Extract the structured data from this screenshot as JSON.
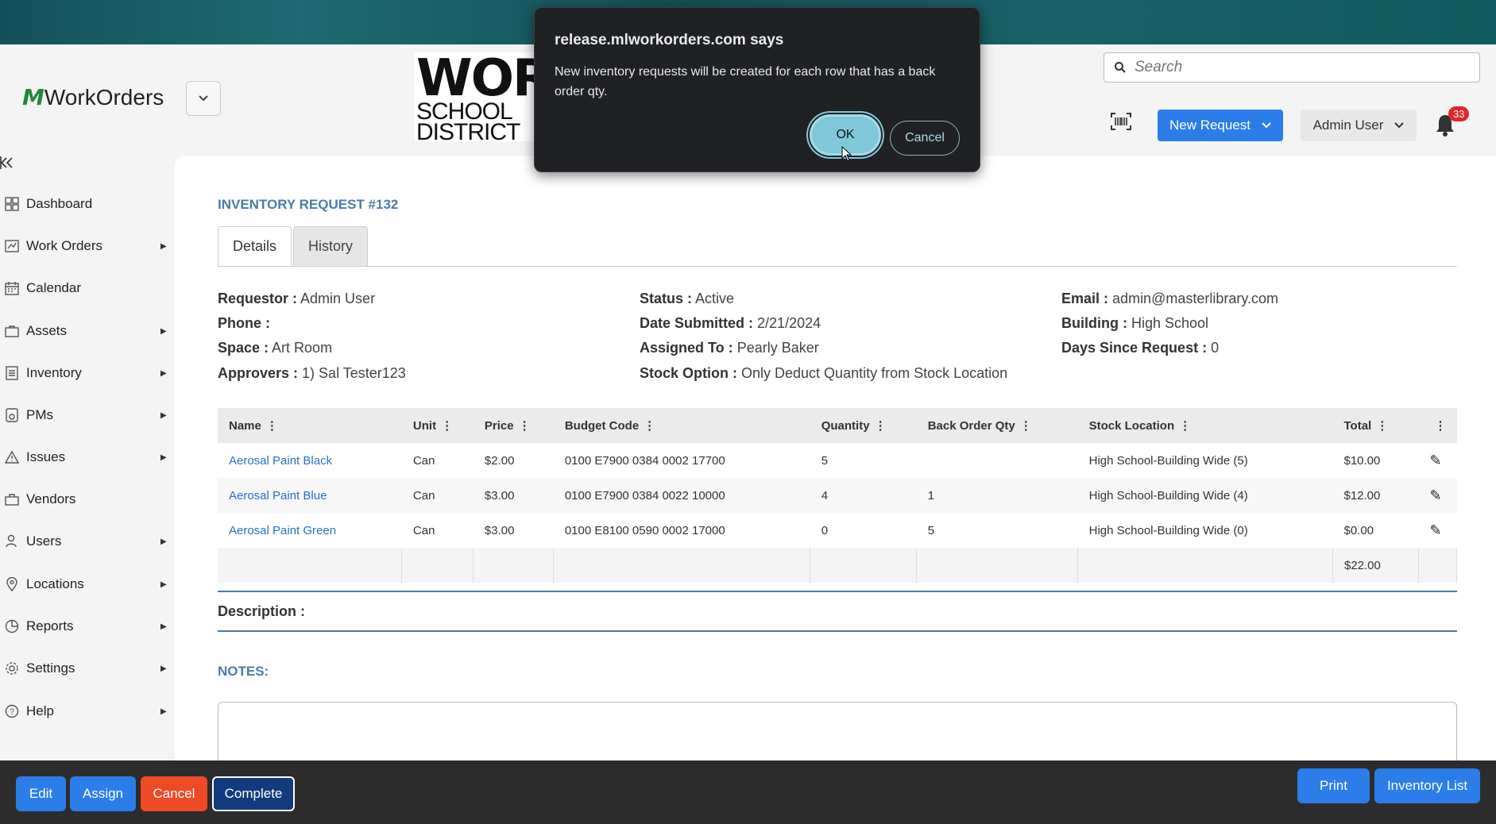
{
  "header": {
    "brand_name": "WorkOrders",
    "district_big": "WOR",
    "district_line1": "SCHOOL",
    "district_line2": "DISTRICT",
    "search_placeholder": "Search",
    "new_request_label": "New Request",
    "user_label": "Admin User",
    "notification_count": "33"
  },
  "sidebar": {
    "items": [
      {
        "label": "Dashboard",
        "icon": "dashboard-icon",
        "has_submenu": false
      },
      {
        "label": "Work Orders",
        "icon": "work-orders-icon",
        "has_submenu": true
      },
      {
        "label": "Calendar",
        "icon": "calendar-icon",
        "has_submenu": false
      },
      {
        "label": "Assets",
        "icon": "assets-icon",
        "has_submenu": true
      },
      {
        "label": "Inventory",
        "icon": "inventory-icon",
        "has_submenu": true
      },
      {
        "label": "PMs",
        "icon": "pms-icon",
        "has_submenu": true
      },
      {
        "label": "Issues",
        "icon": "issues-icon",
        "has_submenu": true
      },
      {
        "label": "Vendors",
        "icon": "vendors-icon",
        "has_submenu": false
      },
      {
        "label": "Users",
        "icon": "users-icon",
        "has_submenu": true
      },
      {
        "label": "Locations",
        "icon": "locations-icon",
        "has_submenu": true
      },
      {
        "label": "Reports",
        "icon": "reports-icon",
        "has_submenu": true
      },
      {
        "label": "Settings",
        "icon": "settings-icon",
        "has_submenu": true
      },
      {
        "label": "Help",
        "icon": "help-icon",
        "has_submenu": true
      }
    ]
  },
  "request": {
    "title": "INVENTORY REQUEST #132",
    "tabs": [
      "Details",
      "History"
    ],
    "fields": {
      "requestor_label": "Requestor :",
      "requestor": "Admin User",
      "phone_label": "Phone :",
      "phone": "",
      "space_label": "Space :",
      "space": "Art Room",
      "approvers_label": "Approvers :",
      "approvers": "1) Sal Tester123",
      "status_label": "Status :",
      "status": "Active",
      "date_label": "Date Submitted :",
      "date": "2/21/2024",
      "assigned_label": "Assigned To :",
      "assigned": "Pearly Baker",
      "stock_label": "Stock Option :",
      "stock": "Only Deduct Quantity from Stock Location",
      "email_label": "Email :",
      "email": "admin@masterlibrary.com",
      "building_label": "Building :",
      "building": "High School",
      "days_label": "Days Since Request :",
      "days": "0"
    },
    "table": {
      "headers": [
        "Name",
        "Unit",
        "Price",
        "Budget Code",
        "Quantity",
        "Back Order Qty",
        "Stock Location",
        "Total"
      ],
      "rows": [
        {
          "name": "Aerosal Paint Black",
          "unit": "Can",
          "price": "$2.00",
          "budget": "0100 E7900 0384 0002 17700",
          "qty": "5",
          "backorder": "",
          "stock": "High School-Building Wide (5)",
          "total": "$10.00"
        },
        {
          "name": "Aerosal Paint Blue",
          "unit": "Can",
          "price": "$3.00",
          "budget": "0100 E7900 0384 0022 10000",
          "qty": "4",
          "backorder": "1",
          "stock": "High School-Building Wide (4)",
          "total": "$12.00"
        },
        {
          "name": "Aerosal Paint Green",
          "unit": "Can",
          "price": "$3.00",
          "budget": "0100 E8100 0590 0002 17000",
          "qty": "0",
          "backorder": "5",
          "stock": "High School-Building Wide (0)",
          "total": "$0.00"
        }
      ],
      "grand_total": "$22.00"
    },
    "description_label": "Description :",
    "notes_label": "NOTES:"
  },
  "bottom": {
    "edit": "Edit",
    "assign": "Assign",
    "cancel": "Cancel",
    "complete": "Complete",
    "print": "Print",
    "inventory_list": "Inventory List"
  },
  "dialog": {
    "title": "release.mlworkorders.com says",
    "message": "New inventory requests will be created for each row that has a back order qty.",
    "ok": "OK",
    "cancel": "Cancel"
  },
  "colors": {
    "accent_blue": "#2b7de9",
    "title_blue": "#4a7ab0",
    "danger": "#ef4a26",
    "complete_navy": "#123a7c",
    "dialog_bg": "#202124",
    "ok_button": "#7fc8d8"
  }
}
